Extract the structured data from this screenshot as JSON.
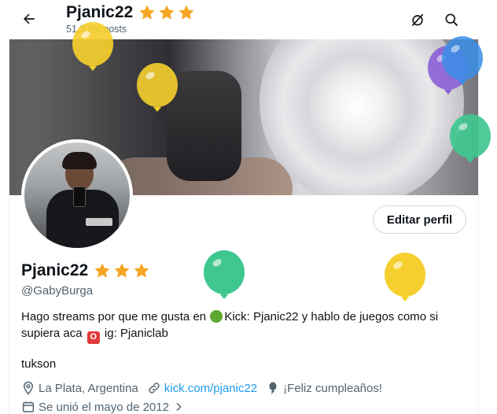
{
  "header": {
    "title": "Pjanic22",
    "posts_count": "51,3 mil posts",
    "back_icon": "arrow-left-icon",
    "actions": [
      "no-signal-icon",
      "search-icon"
    ]
  },
  "profile": {
    "display_name": "Pjanic22",
    "handle": "@GabyBurga",
    "edit_button": "Editar perfil",
    "bio_part1": "Hago streams por que me gusta en",
    "bio_part2": "Kick: Pjanic22 y hablo de juegos como si supiera aca",
    "bio_part3": "ig: Pjaniclab",
    "extra_line": "tukson",
    "location": "La Plata, Argentina",
    "website": "kick.com/pjanic22",
    "birthday": "¡Feliz cumpleaños!",
    "joined": "Se unió el mayo de 2012"
  },
  "colors": {
    "star": "#f5a623",
    "link": "#1d9bf0",
    "muted": "#536471",
    "balloon_yellow": "#f5cf2e",
    "balloon_green": "#3fc78f",
    "balloon_blue": "#3a8ee6",
    "balloon_purple": "#8b5fd6"
  }
}
